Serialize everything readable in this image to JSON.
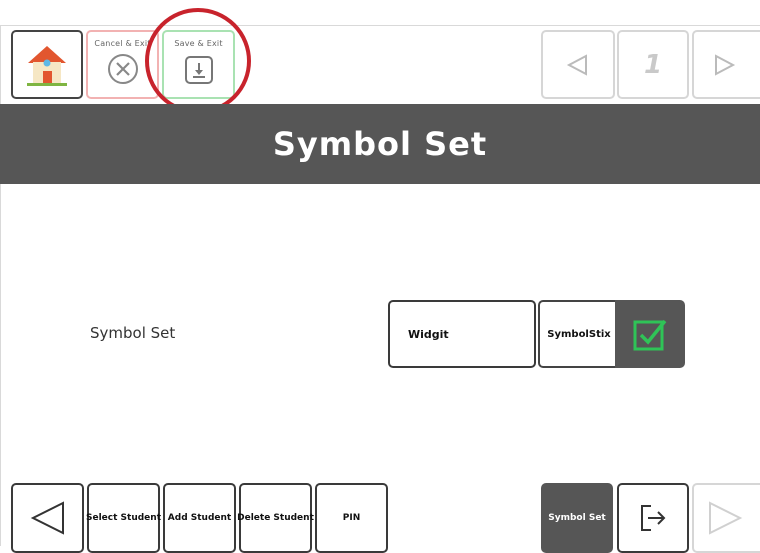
{
  "toolbar": {
    "home_icon": "house-icon",
    "cancel_label": "Cancel & Exit",
    "cancel_icon": "circle-x-icon",
    "save_label": "Save & Exit",
    "save_icon": "download-icon",
    "page_number": "1",
    "prev_icon": "triangle-left-icon",
    "next_icon": "triangle-right-icon"
  },
  "header": {
    "title": "Symbol Set"
  },
  "setting": {
    "label": "Symbol Set",
    "options": [
      "Widgit",
      "SymbolStix"
    ],
    "selected": "SymbolStix"
  },
  "bottom_bar": {
    "select_student": "Select Student",
    "add_student": "Add Student",
    "delete_student": "Delete Student",
    "pin": "PIN",
    "symbol_set": "Symbol Set",
    "exit_icon": "exit-arrow-icon"
  },
  "colors": {
    "title_bar": "#565656",
    "cancel_border": "#f2b2b2",
    "save_border": "#a9e2b2",
    "check": "#2fc457",
    "highlight_ring": "#c8232c"
  }
}
